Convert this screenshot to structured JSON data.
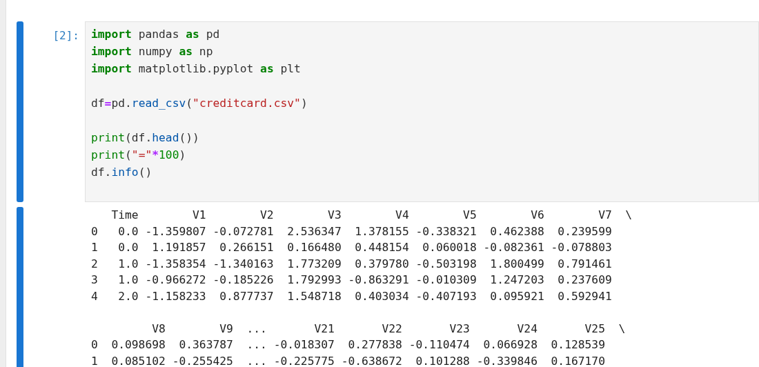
{
  "cells": [
    {
      "prompt": "[2]:",
      "active": true,
      "code_groups": [
        [
          [
            {
              "text": "import",
              "kind": "keyword"
            },
            {
              "text": " pandas ",
              "kind": "name"
            },
            {
              "text": "as",
              "kind": "keyword"
            },
            {
              "text": " pd",
              "kind": "name"
            }
          ],
          [
            {
              "text": "import",
              "kind": "keyword"
            },
            {
              "text": " numpy ",
              "kind": "name"
            },
            {
              "text": "as",
              "kind": "keyword"
            },
            {
              "text": " np",
              "kind": "name"
            }
          ],
          [
            {
              "text": "import",
              "kind": "keyword"
            },
            {
              "text": " matplotlib.pyplot ",
              "kind": "name"
            },
            {
              "text": "as",
              "kind": "keyword"
            },
            {
              "text": " plt",
              "kind": "name"
            }
          ]
        ],
        [
          [
            {
              "text": "df",
              "kind": "name"
            },
            {
              "text": "=",
              "kind": "operator"
            },
            {
              "text": "pd.",
              "kind": "name"
            },
            {
              "text": "read_csv",
              "kind": "property"
            },
            {
              "text": "(",
              "kind": "name"
            },
            {
              "text": "\"creditcard.csv\"",
              "kind": "string"
            },
            {
              "text": ")",
              "kind": "name"
            }
          ]
        ],
        [
          [
            {
              "text": "print",
              "kind": "builtin"
            },
            {
              "text": "(df.",
              "kind": "name"
            },
            {
              "text": "head",
              "kind": "property"
            },
            {
              "text": "())",
              "kind": "name"
            }
          ],
          [
            {
              "text": "print",
              "kind": "builtin"
            },
            {
              "text": "(",
              "kind": "name"
            },
            {
              "text": "\"=\"",
              "kind": "string"
            },
            {
              "text": "*",
              "kind": "operator"
            },
            {
              "text": "100",
              "kind": "number"
            },
            {
              "text": ")",
              "kind": "name"
            }
          ],
          [
            {
              "text": "df.",
              "kind": "name"
            },
            {
              "text": "info",
              "kind": "property"
            },
            {
              "text": "()",
              "kind": "name"
            }
          ]
        ]
      ],
      "output_blocks": [
        [
          "   Time        V1        V2        V3        V4        V5        V6        V7  \\",
          "0   0.0 -1.359807 -0.072781  2.536347  1.378155 -0.338321  0.462388  0.239599",
          "1   0.0  1.191857  0.266151  0.166480  0.448154  0.060018 -0.082361 -0.078803",
          "2   1.0 -1.358354 -1.340163  1.773209  0.379780 -0.503198  1.800499  0.791461",
          "3   1.0 -0.966272 -0.185226  1.792993 -0.863291 -0.010309  1.247203  0.237609",
          "4   2.0 -1.158233  0.877737  1.548718  0.403034 -0.407193  0.095921  0.592941"
        ],
        [
          "         V8        V9  ...       V21       V22       V23       V24       V25  \\",
          "0  0.098698  0.363787  ... -0.018307  0.277838 -0.110474  0.066928  0.128539",
          "1  0.085102 -0.255425  ... -0.225775 -0.638672  0.101288 -0.339846  0.167170"
        ]
      ]
    }
  ]
}
